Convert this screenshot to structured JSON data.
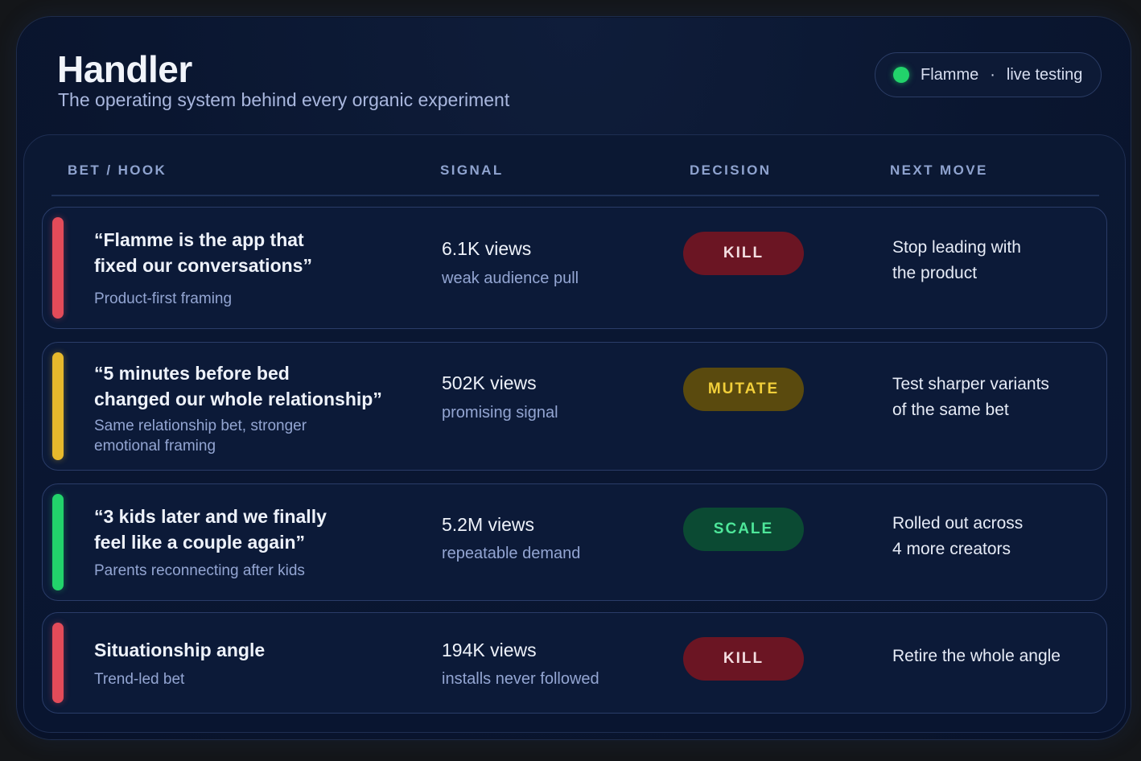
{
  "header": {
    "title": "Handler",
    "subtitle": "The operating system behind every organic experiment",
    "status": {
      "app": "Flamme",
      "separator": "·",
      "state": "live testing",
      "dot_color": "#22d36b"
    }
  },
  "columns": [
    "BET / HOOK",
    "SIGNAL",
    "DECISION",
    "NEXT MOVE"
  ],
  "rows": [
    {
      "hook_line1": "“Flamme is the app that",
      "hook_line2": "fixed our conversations”",
      "sub_line1": "Product-first framing",
      "sub_line2": "",
      "views": "6.1K views",
      "signal": "weak audience pull",
      "decision": "KILL",
      "next_line1": "Stop leading with",
      "next_line2": "the product",
      "bar_color": "#e34b59"
    },
    {
      "hook_line1": "“5 minutes before bed",
      "hook_line2": "changed our whole relationship”",
      "sub_line1": "Same relationship bet, stronger",
      "sub_line2": "emotional framing",
      "views": "502K views",
      "signal": "promising signal",
      "decision": "MUTATE",
      "next_line1": "Test sharper variants",
      "next_line2": "of the same bet",
      "bar_color": "#e7b92c"
    },
    {
      "hook_line1": "“3 kids later and we finally",
      "hook_line2": "feel like a couple again”",
      "sub_line1": "Parents reconnecting after kids",
      "sub_line2": "",
      "views": "5.2M views",
      "signal": "repeatable demand",
      "decision": "SCALE",
      "next_line1": "Rolled out across",
      "next_line2": "4 more creators",
      "bar_color": "#22d36b"
    },
    {
      "hook_line1": "Situationship angle",
      "hook_line2": "",
      "sub_line1": "Trend-led bet",
      "sub_line2": "",
      "views": "194K views",
      "signal": "installs never followed",
      "decision": "KILL",
      "next_line1": "Retire the whole angle",
      "next_line2": "",
      "bar_color": "#e34b59"
    }
  ]
}
